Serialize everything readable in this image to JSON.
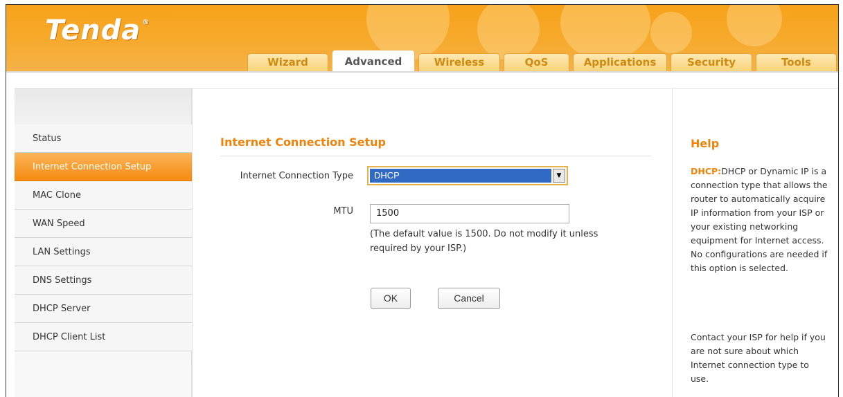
{
  "brand": {
    "logo": "Tenda",
    "reg_mark": "®"
  },
  "tabs": [
    {
      "label": "Wizard"
    },
    {
      "label": "Advanced"
    },
    {
      "label": "Wireless"
    },
    {
      "label": "QoS"
    },
    {
      "label": "Applications"
    },
    {
      "label": "Security"
    },
    {
      "label": "Tools"
    }
  ],
  "active_tab": "Advanced",
  "sidebar": {
    "items": [
      {
        "label": "Status"
      },
      {
        "label": "Internet Connection Setup"
      },
      {
        "label": "MAC Clone"
      },
      {
        "label": "WAN Speed"
      },
      {
        "label": "LAN Settings"
      },
      {
        "label": "DNS Settings"
      },
      {
        "label": "DHCP Server"
      },
      {
        "label": "DHCP Client List"
      }
    ],
    "active_item": "Internet Connection Setup"
  },
  "main": {
    "title": "Internet Connection Setup",
    "connection_type_label": "Internet Connection Type",
    "connection_type_value": "DHCP",
    "mtu_label": "MTU",
    "mtu_value": "1500",
    "mtu_note": "(The default value is 1500. Do not modify it unless required by your ISP.)",
    "ok_label": "OK",
    "cancel_label": "Cancel"
  },
  "help": {
    "title": "Help",
    "keyword": "DHCP:",
    "text1": "DHCP or Dynamic IP is a connection type that allows the router to automatically acquire IP information from your ISP or your existing networking equipment for Internet access. No configurations are needed if this option is selected.",
    "text2": "Contact your ISP for help if you are not sure about which Internet connection type to use."
  },
  "colors": {
    "brand_orange": "#f7a21a",
    "accent_orange": "#f0820a",
    "selection_blue": "#316ac5"
  },
  "icons": {
    "select_arrow": "chevron-down-icon"
  }
}
